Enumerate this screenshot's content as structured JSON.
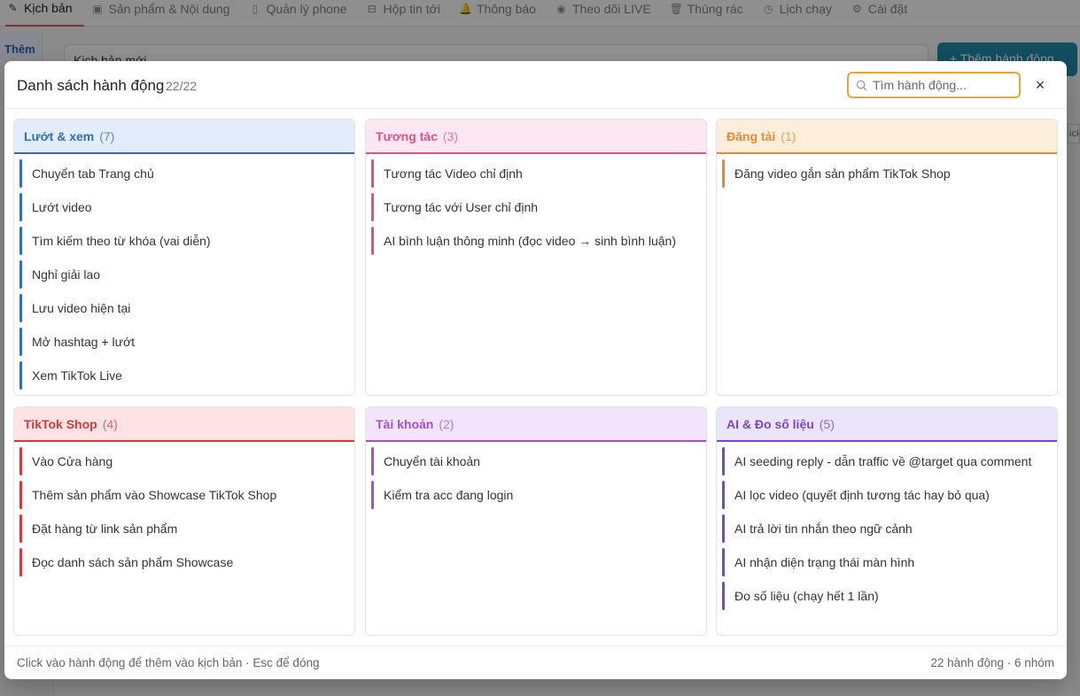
{
  "nav": {
    "tabs": [
      {
        "label": "Kịch bản",
        "icon": "pencil-icon",
        "active": true
      },
      {
        "label": "Sản phẩm & Nội dung",
        "icon": "box-icon"
      },
      {
        "label": "Quản lý phone",
        "icon": "phone-icon"
      },
      {
        "label": "Hộp tin tới",
        "icon": "inbox-icon"
      },
      {
        "label": "Thông báo",
        "icon": "bell-icon"
      },
      {
        "label": "Theo dõi LIVE",
        "icon": "live-icon"
      },
      {
        "label": "Thùng rác",
        "icon": "trash-icon"
      },
      {
        "label": "Lịch chạy",
        "icon": "clock-icon"
      },
      {
        "label": "Cài đặt",
        "icon": "gear-icon"
      }
    ]
  },
  "background": {
    "side_tab": "Thêm",
    "scenario_value": "Kịch bản mới",
    "add_action_button": "+ Thêm hành động",
    "right_stub": "ick"
  },
  "modal": {
    "title": "Danh sách hành động",
    "count": "22/22",
    "search_placeholder": "Tìm hành động...",
    "close_icon": "×",
    "footer_left": "Click vào hành động để thêm vào kịch bản · Esc để đóng",
    "footer_right": "22 hành động · 6 nhóm"
  },
  "groups": [
    {
      "title": "Lướt & xem",
      "count": "(7)",
      "color": "#2f6fb5",
      "head_bg": "#e3ecfb",
      "count_color": "#5f86c4",
      "items": [
        "Chuyển tab Trang chủ",
        "Lướt video",
        "Tìm kiếm theo từ khóa (vai diễn)",
        "Nghỉ giải lao",
        "Lưu video hiện tại",
        "Mở hashtag + lướt",
        "Xem TikTok Live"
      ]
    },
    {
      "title": "Tương tác",
      "count": "(3)",
      "color": "#d94f91",
      "head_bg": "#fce6f1",
      "count_color": "#e07aad",
      "items": [
        "Tương tác Video chỉ định",
        "Tương tác với User chỉ định",
        "AI bình luận thông minh (đọc video → sinh bình luận)"
      ]
    },
    {
      "title": "Đăng tải",
      "count": "(1)",
      "color": "#e8892e",
      "head_bg": "#fdeedb",
      "count_color": "#ed9d52",
      "items": [
        "Đăng video gắn sản phẩm TikTok Shop"
      ]
    },
    {
      "title": "TikTok Shop",
      "count": "(4)",
      "color": "#cf3a3f",
      "head_bg": "#fde3e4",
      "count_color": "#d9676b",
      "items": [
        "Vào Cửa hàng",
        "Thêm sản phẩm vào Showcase TikTok Shop",
        "Đặt hàng từ link sản phẩm",
        "Đọc danh sách sản phẩm Showcase"
      ]
    },
    {
      "title": "Tài khoản",
      "count": "(2)",
      "color": "#a452c9",
      "head_bg": "#f2e4fb",
      "count_color": "#b67ad3",
      "items": [
        "Chuyển tài khoản",
        "Kiểm tra acc đang login"
      ]
    },
    {
      "title": "AI & Đo số liệu",
      "count": "(5)",
      "color": "#7a45c8",
      "head_bg": "#ebe5fb",
      "count_color": "#8f69cf",
      "items": [
        "AI seeding reply - dẫn traffic về @target qua comment",
        "AI lọc video (quyết định tương tác hay bỏ qua)",
        "AI trả lời tin nhắn theo ngữ cảnh",
        "AI nhận diện trạng thái màn hình",
        "Đo số liệu (chạy hết 1 lần)"
      ]
    }
  ]
}
